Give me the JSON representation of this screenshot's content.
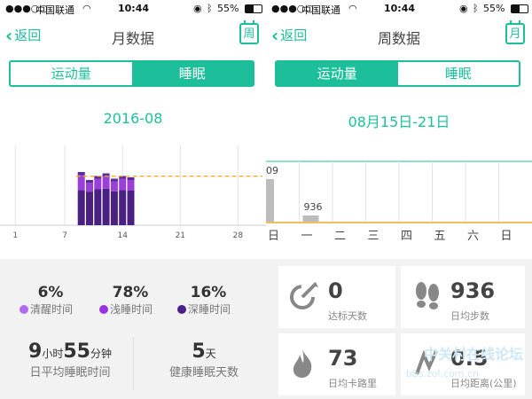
{
  "left": {
    "status": {
      "carrier": "中国联通",
      "time": "10:44",
      "battery": "55%"
    },
    "nav": {
      "back_label": "返回",
      "title": "月数据",
      "calendar_label": "周"
    },
    "segment": {
      "tab1": "运动量",
      "tab2": "睡眠",
      "active": "tab2"
    },
    "period": "2016-08",
    "chart_data": {
      "type": "bar",
      "stacked": true,
      "x_ticks": [
        "1",
        "7",
        "14",
        "21",
        "28"
      ],
      "x_tick_positions_day": [
        1,
        7,
        14,
        21,
        28
      ],
      "days": [
        9,
        10,
        11,
        12,
        13,
        14,
        15
      ],
      "series": [
        {
          "values": [
            5.3,
            5.0,
            5.4,
            5.5,
            5.1,
            5.3,
            5.2
          ]
        },
        {
          "values": [
            2.2,
            1.4,
            1.6,
            1.8,
            1.5,
            1.7,
            1.6
          ]
        },
        {
          "values": [
            0.5,
            0.4,
            0.4,
            0.5,
            0.4,
            0.4,
            0.4
          ]
        }
      ],
      "colors": [
        "#4a2080",
        "#9b3fd9",
        "#5b2a9a"
      ],
      "ylim": [
        0,
        12
      ],
      "average_line": true
    },
    "stats": {
      "awake": {
        "pct": "6%",
        "label": "清醒时间",
        "color": "#b06cf0"
      },
      "light": {
        "pct": "78%",
        "label": "浅睡时间",
        "color": "#9a34dc"
      },
      "deep": {
        "pct": "16%",
        "label": "深睡时间",
        "color": "#4b1f8c"
      }
    },
    "avg_sleep": {
      "hours": "9",
      "h_unit": "小时",
      "minutes": "55",
      "m_unit": "分钟",
      "label": "日平均睡眠时间"
    },
    "healthy_days": {
      "value": "5",
      "unit": "天",
      "label": "健康睡眠天数"
    }
  },
  "right": {
    "status": {
      "carrier": "中国联通",
      "time": "10:44",
      "battery": "55%"
    },
    "nav": {
      "back_label": "返回",
      "title": "周数据",
      "calendar_label": "月"
    },
    "segment": {
      "tab1": "运动量",
      "tab2": "睡眠",
      "active": "tab1"
    },
    "period": "08月15日-21日",
    "chart_data": {
      "type": "bar",
      "x_ticks": [
        "日",
        "一",
        "二",
        "三",
        "四",
        "五",
        "六",
        "日"
      ],
      "bar_values": [
        6409,
        936
      ],
      "bar_labels": [
        "09",
        "936"
      ],
      "goal_line": true
    },
    "tiles": {
      "target_days": {
        "value": "0",
        "label": "达标天数",
        "icon": "target-icon"
      },
      "avg_steps": {
        "value": "936",
        "label": "日均步数",
        "icon": "footprint-icon"
      },
      "avg_calories": {
        "value": "73",
        "label": "日均卡路里",
        "icon": "flame-icon"
      },
      "avg_distance": {
        "value": "0.5",
        "label": "日均距离(公里)",
        "icon": "route-icon"
      }
    },
    "watermark": "中关村在线论坛",
    "watermark_url": "bbs.zol.com.cn"
  }
}
